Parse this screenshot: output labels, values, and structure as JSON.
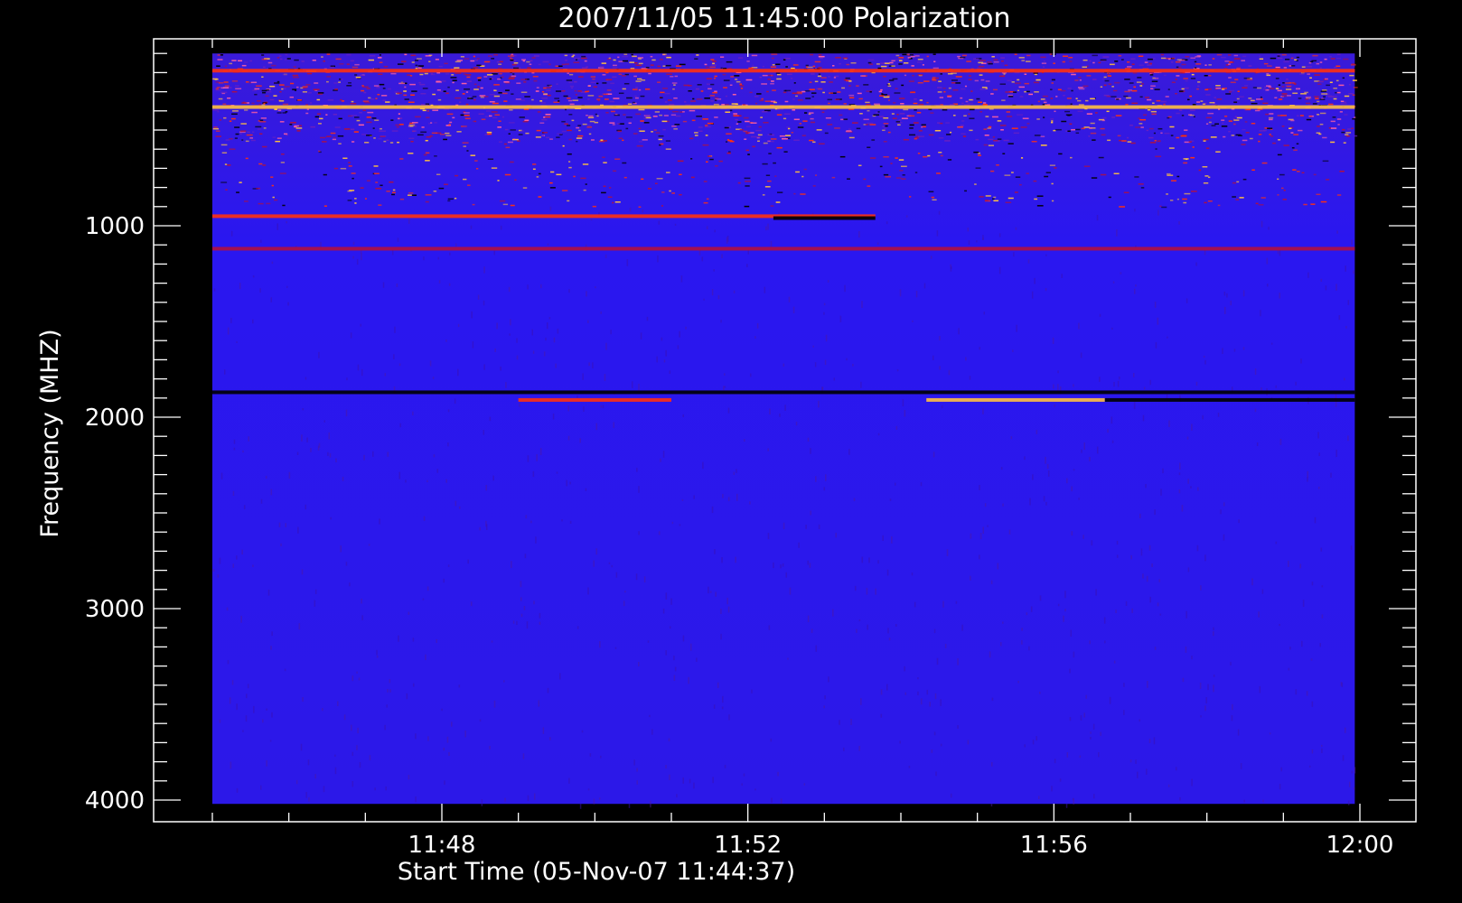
{
  "chart_data": {
    "type": "heatmap",
    "title": "2007/11/05 11:45:00 Polarization",
    "xlabel": "Start Time (05-Nov-07 11:44:37)",
    "ylabel": "Frequency (MHZ)",
    "x_ticks": [
      "11:48",
      "11:52",
      "11:56",
      "12:00"
    ],
    "y_ticks": [
      1000,
      2000,
      3000,
      4000
    ],
    "x_range": [
      "11:44:37",
      "12:00:00"
    ],
    "y_range": [
      100,
      4000
    ],
    "y_inverted": true,
    "data_time_range": [
      "11:45:00",
      "11:59:56"
    ],
    "data_freq_range": [
      100,
      4020
    ],
    "colors": {
      "background": "#000000",
      "axis": "#ffffff",
      "baseline": "#2a17f0",
      "baseline_low": "#3a1ad8",
      "emission_low": "#b01040",
      "emission_mid": "#ff3010",
      "emission_high": "#ffc040",
      "absorption": "#000000"
    },
    "features": [
      {
        "kind": "noise_band",
        "freq": [
          100,
          380
        ],
        "level": "high"
      },
      {
        "kind": "noise_band",
        "freq": [
          380,
          560
        ],
        "level": "mid"
      },
      {
        "kind": "noise_band",
        "freq": [
          560,
          900
        ],
        "level": "low"
      },
      {
        "kind": "line",
        "freq": 190,
        "time": [
          "11:45:00",
          "11:59:56"
        ],
        "color": "emission_mid"
      },
      {
        "kind": "line",
        "freq": 380,
        "time": [
          "11:45:00",
          "11:59:56"
        ],
        "color": "emission_high"
      },
      {
        "kind": "line",
        "freq": 950,
        "time": [
          "11:45:00",
          "11:53:40"
        ],
        "color": "emission_mid"
      },
      {
        "kind": "line",
        "freq": 960,
        "time": [
          "11:52:20",
          "11:53:40"
        ],
        "color": "absorption"
      },
      {
        "kind": "line",
        "freq": 1120,
        "time": [
          "11:45:00",
          "11:59:56"
        ],
        "color": "emission_low"
      },
      {
        "kind": "line",
        "freq": 1870,
        "time": [
          "11:45:00",
          "11:59:56"
        ],
        "color": "absorption"
      },
      {
        "kind": "line",
        "freq": 1910,
        "time": [
          "11:49:00",
          "11:51:00"
        ],
        "color": "emission_mid"
      },
      {
        "kind": "line",
        "freq": 1910,
        "time": [
          "11:54:20",
          "11:56:40"
        ],
        "color": "emission_high"
      },
      {
        "kind": "line",
        "freq": 1910,
        "time": [
          "11:56:40",
          "11:59:56"
        ],
        "color": "absorption"
      }
    ]
  }
}
